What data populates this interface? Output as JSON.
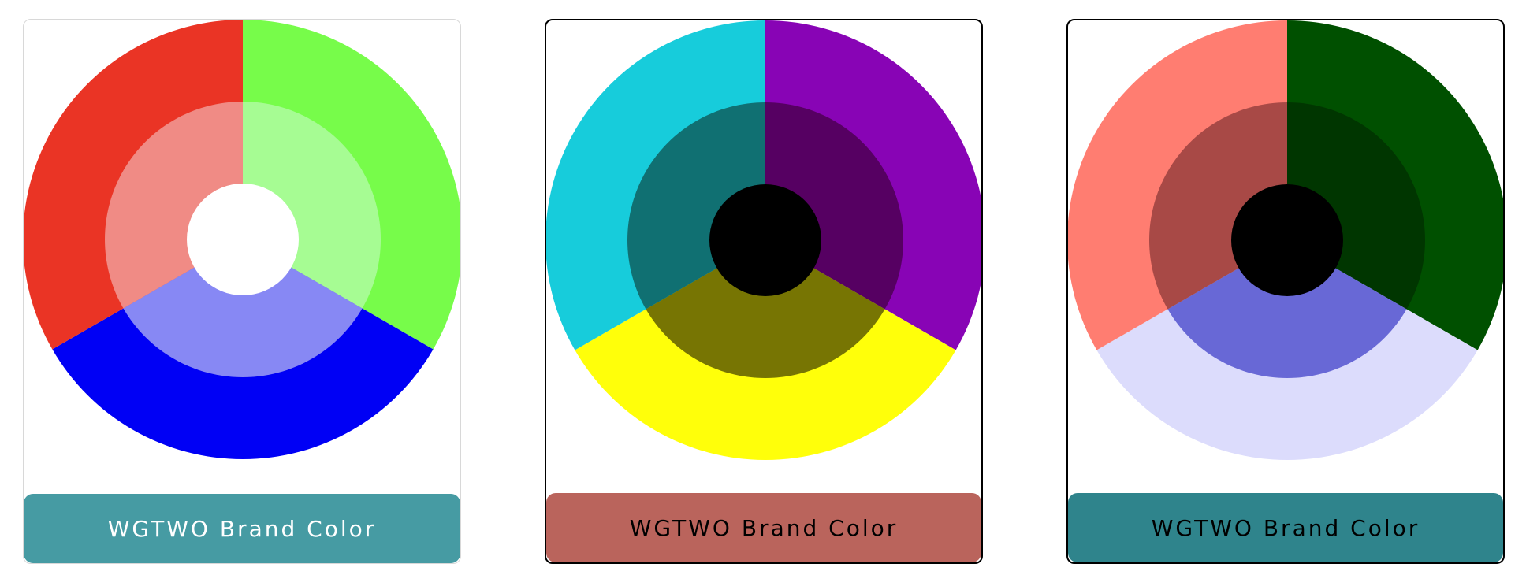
{
  "cards": [
    {
      "label": "WGTWO Brand Color",
      "label_bg": "#469BA3",
      "label_color": "#FFFFFF",
      "outer_colors": [
        "#77FC4A",
        "#0000F5",
        "#EA3425"
      ],
      "mid_colors": [
        "#A6FC93",
        "#8788F4",
        "#F08B85"
      ],
      "center_color": "#FFFFFF"
    },
    {
      "label": "WGTWO Brand Color",
      "label_bg": "#BA645C",
      "label_color": "#000000",
      "outer_colors": [
        "#8804B5",
        "#FFFF0A",
        "#17CCDB"
      ],
      "mid_colors": [
        "#560062",
        "#777503",
        "#107072"
      ],
      "center_color": "#000000"
    },
    {
      "label": "WGTWO Brand Color",
      "label_bg": "#2F848C",
      "label_color": "#000000",
      "outer_colors": [
        "#005000",
        "#DCDCFC",
        "#FF7D71"
      ],
      "mid_colors": [
        "#003600",
        "#6868D6",
        "#A84946"
      ],
      "center_color": "#000000"
    }
  ]
}
